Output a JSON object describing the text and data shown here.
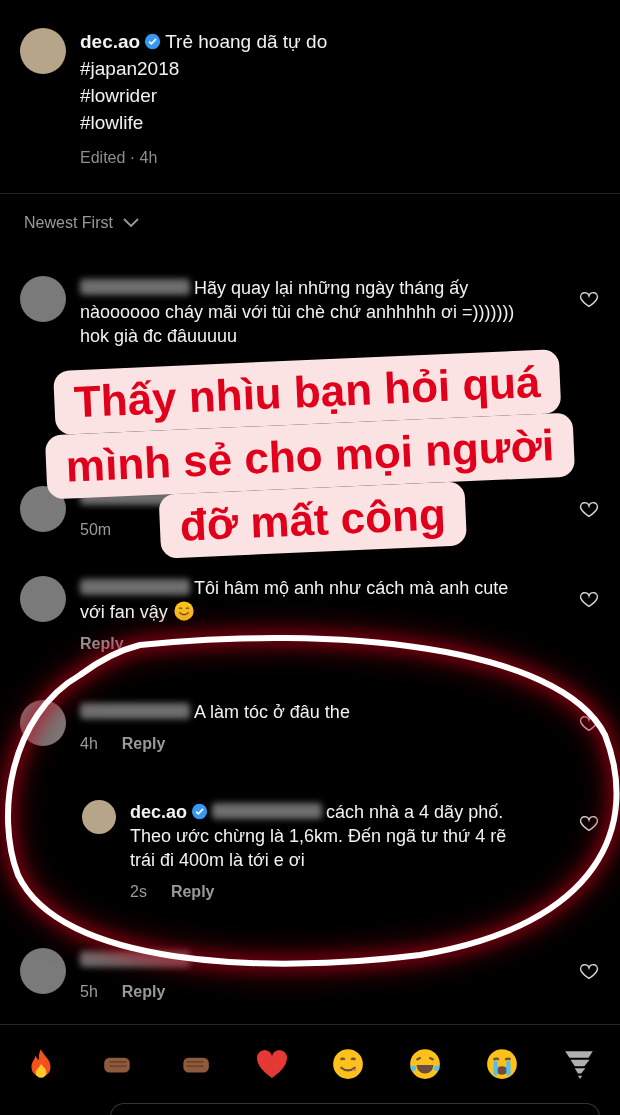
{
  "caption": {
    "username": "dec.ao",
    "verified": true,
    "lines": [
      "Trẻ hoang dã tự do",
      "#japan2018",
      "#lowrider",
      "#lowlife"
    ],
    "meta": "Edited · 4h"
  },
  "sort": {
    "label": "Newest First"
  },
  "comments": [
    {
      "kind": "comment",
      "text": "Hãy quay lại những ngày tháng ấy nàoooooo cháy mãi với tùi chè chứ anhhhhh ơi =))))))) hok già đc đâuuuuu"
    },
    {
      "kind": "comment",
      "time": "50m"
    },
    {
      "kind": "comment",
      "text": "Tôi hâm mộ anh như cách mà anh cute với fan vậy",
      "trailing_emoji": {
        "kind": "smiling"
      },
      "reply": "Reply"
    },
    {
      "kind": "comment",
      "text": "A làm tóc ở đâu the",
      "time": "4h",
      "reply": "Reply"
    },
    {
      "kind": "reply",
      "username": "dec.ao",
      "verified": true,
      "text": "cách nhà a 4 dãy phố. Theo ước chừng là 1,6km. Đến ngã tư thứ 4 rẽ trái đi 400m là tới e ơi",
      "time": "2s",
      "reply": "Reply"
    },
    {
      "kind": "comment",
      "time": "5h",
      "reply": "Reply"
    }
  ],
  "sticker": {
    "lines": [
      "Thấy nhìu bạn hỏi quá",
      "mình sẻ cho mọi người",
      "đỡ mất công"
    ]
  },
  "emoji_bar": [
    {
      "kind": "fire"
    },
    {
      "kind": "fist-right"
    },
    {
      "kind": "fist-left"
    },
    {
      "kind": "heart"
    },
    {
      "kind": "yum"
    },
    {
      "kind": "laugh"
    },
    {
      "kind": "cry"
    },
    {
      "kind": "tornado"
    }
  ]
}
